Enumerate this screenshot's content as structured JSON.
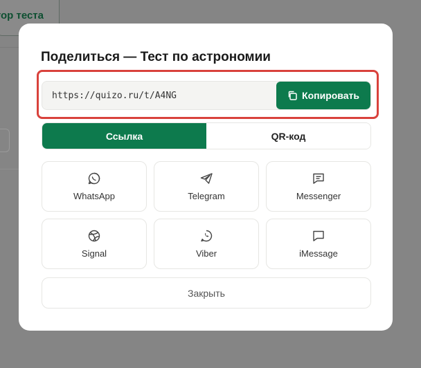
{
  "background": {
    "top_button_label": "тор теста"
  },
  "modal": {
    "title": "Поделиться — Тест по астрономии",
    "link_url": "https://quizo.ru/t/A4NG",
    "copy_label": "Копировать",
    "tabs": [
      {
        "label": "Ссылка",
        "active": true
      },
      {
        "label": "QR-код",
        "active": false
      }
    ],
    "share_options": [
      {
        "label": "WhatsApp",
        "icon": "whatsapp-icon"
      },
      {
        "label": "Telegram",
        "icon": "telegram-icon"
      },
      {
        "label": "Messenger",
        "icon": "messenger-icon"
      },
      {
        "label": "Signal",
        "icon": "signal-icon"
      },
      {
        "label": "Viber",
        "icon": "viber-icon"
      },
      {
        "label": "iMessage",
        "icon": "imessage-icon"
      }
    ],
    "close_label": "Закрыть"
  },
  "colors": {
    "accent": "#0d7a4d",
    "highlight": "#d9423c",
    "overlay": "#858585"
  }
}
